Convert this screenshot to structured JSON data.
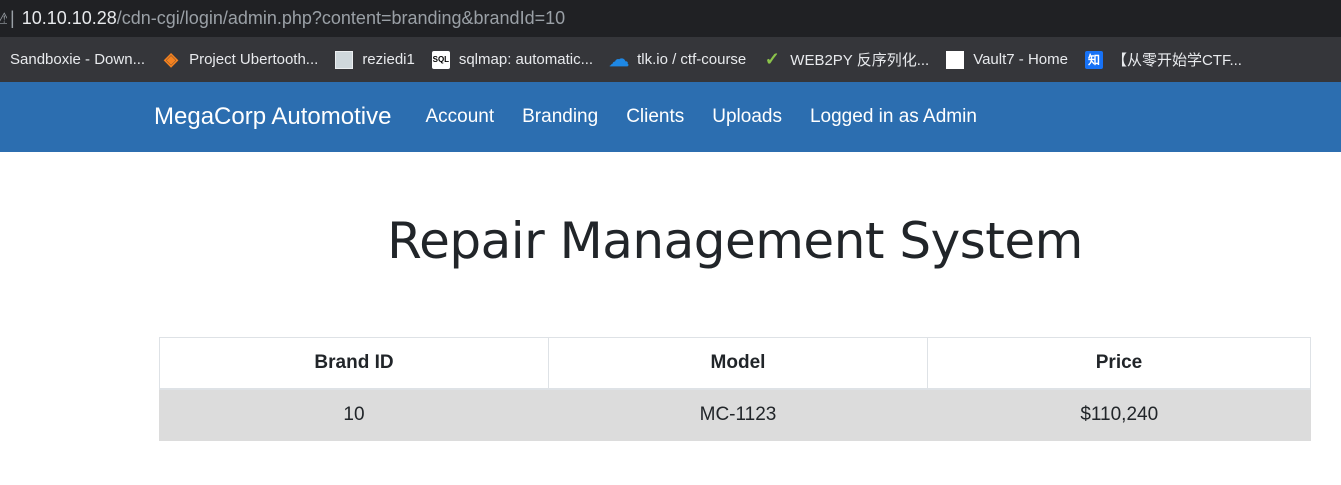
{
  "address_bar": {
    "lock_glyph": "⚠",
    "host": "10.10.10.28",
    "path": "/cdn-cgi/login/admin.php?content=branding&brandId=10"
  },
  "bookmarks": [
    {
      "label": "Sandboxie - Down...",
      "icon": "none"
    },
    {
      "label": "Project Ubertooth...",
      "icon": "diamond-icon"
    },
    {
      "label": "reziedi1",
      "icon": "image-icon"
    },
    {
      "label": "sqlmap: automatic...",
      "icon": "sql-icon"
    },
    {
      "label": "tlk.io / ctf-course",
      "icon": "cloud-icon"
    },
    {
      "label": "WEB2PY 反序列化...",
      "icon": "check-icon"
    },
    {
      "label": "Vault7 - Home",
      "icon": "vault-icon"
    },
    {
      "label": "【从零开始学CTF...",
      "icon": "zhihu-icon"
    }
  ],
  "navbar": {
    "brand": "MegaCorp Automotive",
    "links": [
      "Account",
      "Branding",
      "Clients",
      "Uploads",
      "Logged in as Admin"
    ],
    "color": "#2c6eb0"
  },
  "page_title": "Repair Management System",
  "table": {
    "headers": [
      "Brand ID",
      "Model",
      "Price"
    ],
    "rows": [
      [
        "10",
        "MC-1123",
        "$110,240"
      ]
    ]
  }
}
